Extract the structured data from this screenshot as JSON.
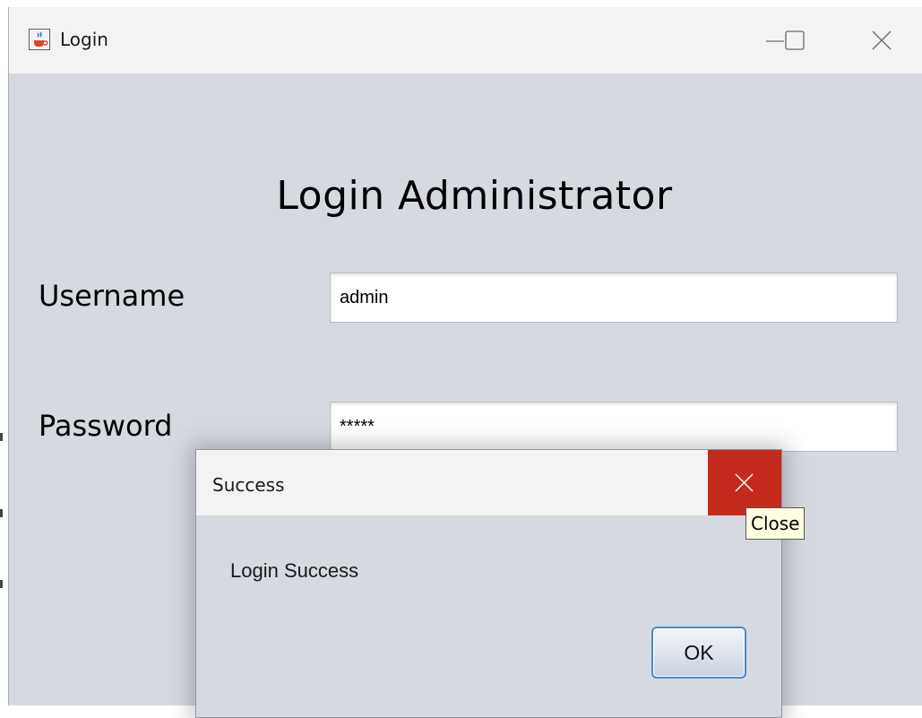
{
  "window": {
    "title": "Login",
    "icon": "java-coffee-icon",
    "controls": {
      "minimize_icon": "minimize-icon",
      "maximize_icon": "maximize-icon",
      "close_icon": "close-icon"
    }
  },
  "form": {
    "heading": "Login Administrator",
    "username_label": "Username",
    "username_value": "admin",
    "password_label": "Password",
    "password_value": "*****"
  },
  "dialog": {
    "title": "Success",
    "message": "Login Success",
    "ok_label": "OK",
    "close_icon": "close-icon",
    "close_color": "#c42b1c"
  },
  "tooltip": {
    "text": "Close"
  }
}
